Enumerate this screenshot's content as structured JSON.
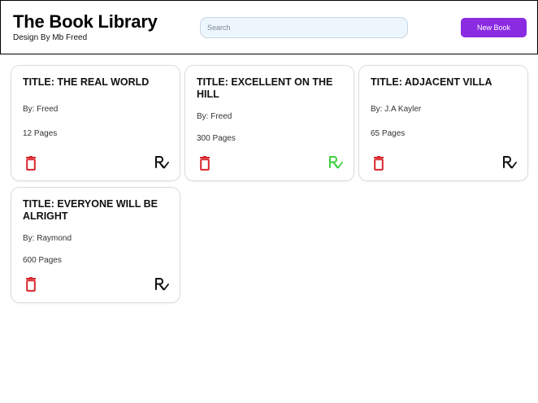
{
  "header": {
    "title": "The Book Library",
    "subtitle": "Design By Mb Freed",
    "search_placeholder": "Search",
    "new_button_label": "New Book"
  },
  "colors": {
    "accent": "#8a2be2",
    "delete": "#d9262c",
    "read_done": "#3ecf3e",
    "read_default": "#111111"
  },
  "books": [
    {
      "title": "TITLE: THE REAL WORLD",
      "author": "By: Freed",
      "pages": "12 Pages",
      "read": false
    },
    {
      "title": "TITLE: EXCELLENT ON THE HILL",
      "author": "By: Freed",
      "pages": "300 Pages",
      "read": true
    },
    {
      "title": "TITLE: ADJACENT VILLA",
      "author": "By: J.A Kayler",
      "pages": "65 Pages",
      "read": false
    },
    {
      "title": "TITLE: EVERYONE WILL BE ALRIGHT",
      "author": "By: Raymond",
      "pages": "600 Pages",
      "read": false
    }
  ],
  "icons": {
    "delete": "trash-icon",
    "read": "prescription-check-icon"
  }
}
